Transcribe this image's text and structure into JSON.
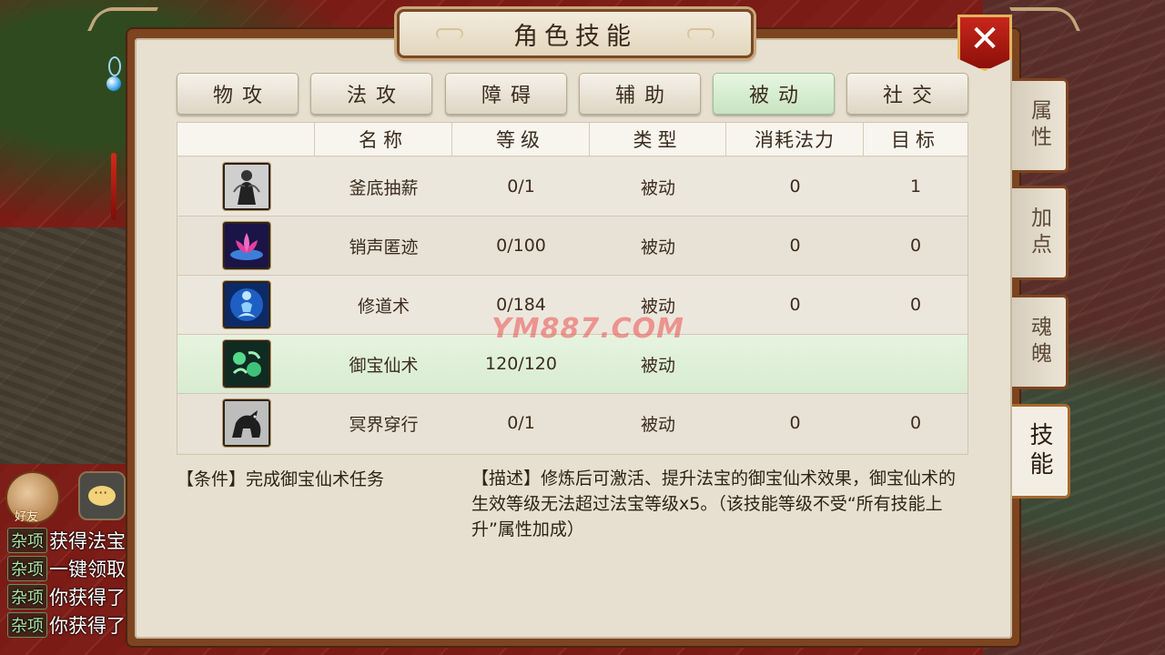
{
  "window": {
    "title": "角色技能",
    "close_label": "✕"
  },
  "category_tabs": [
    {
      "label": "物攻",
      "active": false
    },
    {
      "label": "法攻",
      "active": false
    },
    {
      "label": "障碍",
      "active": false
    },
    {
      "label": "辅助",
      "active": false
    },
    {
      "label": "被动",
      "active": true
    },
    {
      "label": "社交",
      "active": false
    }
  ],
  "table": {
    "headers": [
      "",
      "名称",
      "等级",
      "类型",
      "消耗法力",
      "目标"
    ],
    "rows": [
      {
        "icon": "shadow-figure-icon",
        "name": "釜底抽薪",
        "level": "0/1",
        "type": "被动",
        "mana": "0",
        "target": "1",
        "selected": false
      },
      {
        "icon": "lotus-icon",
        "name": "销声匿迹",
        "level": "0/100",
        "type": "被动",
        "mana": "0",
        "target": "0",
        "selected": false
      },
      {
        "icon": "meditation-icon",
        "name": "修道术",
        "level": "0/184",
        "type": "被动",
        "mana": "0",
        "target": "0",
        "selected": false
      },
      {
        "icon": "jade-treasure-icon",
        "name": "御宝仙术",
        "level": "120/120",
        "type": "被动",
        "mana": "",
        "target": "",
        "selected": true
      },
      {
        "icon": "beast-icon",
        "name": "冥界穿行",
        "level": "0/1",
        "type": "被动",
        "mana": "0",
        "target": "0",
        "selected": false
      }
    ]
  },
  "condition_text": "【条件】完成御宝仙术任务",
  "description_text": "【描述】修炼后可激活、提升法宝的御宝仙术效果，御宝仙术的生效等级无法超过法宝等级x5。（该技能等级不受“所有技能上升”属性加成）",
  "side_tabs": [
    {
      "label": "属性",
      "active": false
    },
    {
      "label": "加点",
      "active": false
    },
    {
      "label": "魂魄",
      "active": false
    },
    {
      "label": "技能",
      "active": true
    }
  ],
  "watermark": "YM887.COM",
  "chat": {
    "friend_label": "好友",
    "lines": [
      {
        "tag": "杂项",
        "text": "获得法宝"
      },
      {
        "tag": "杂项",
        "text": "一键领取"
      },
      {
        "tag": "杂项",
        "text": "你获得了"
      },
      {
        "tag": "杂项",
        "text": "你获得了"
      }
    ]
  },
  "colors": {
    "panel_frame": "#7d4420",
    "panel_bg": "#e7e0d1",
    "active_tab": "#c8e4c0",
    "close_red": "#c8261c"
  }
}
